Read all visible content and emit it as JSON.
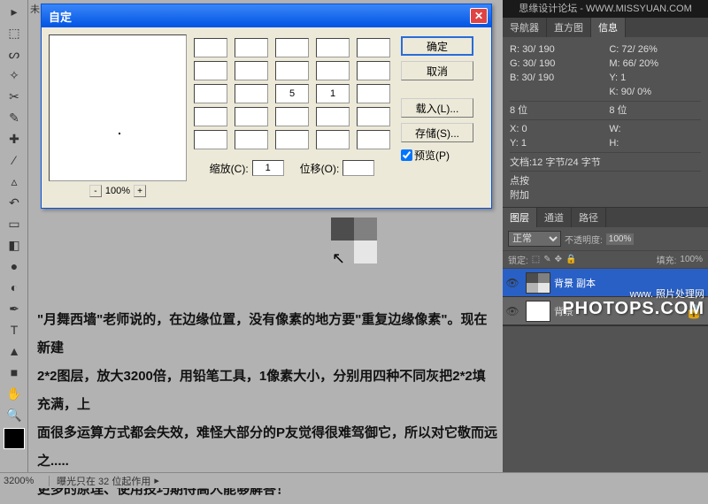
{
  "brand_top": "思缘设计论坛 - WWW.MISSYUAN.COM",
  "doc_tab_prefix": "未",
  "dialog": {
    "title": "自定",
    "ok": "确定",
    "cancel": "取消",
    "load": "载入(L)...",
    "save": "存储(S)...",
    "preview": "预览(P)",
    "zoom": "100%",
    "scale_label": "缩放(C):",
    "scale_value": "1",
    "offset_label": "位移(O):",
    "offset_value": "",
    "cells": [
      "",
      "",
      "",
      "",
      "",
      "",
      "",
      "",
      "",
      "",
      "",
      "",
      "5",
      "1",
      "",
      "",
      "",
      "",
      "",
      "",
      "",
      "",
      "",
      "",
      ""
    ]
  },
  "info_tabs": {
    "nav": "导航器",
    "hist": "直方图",
    "info": "信息"
  },
  "info": {
    "R": "30/ 190",
    "G": "30/ 190",
    "B": "30/ 190",
    "C": "72/  26%",
    "M": "66/  20%",
    "Y": "1",
    "K": "90/    0%",
    "bits_l": "8 位",
    "bits_r": "8 位",
    "X": "0",
    "W": "",
    "H": "",
    "doc": "文档:12 字节/24 字节",
    "hint1": "点按",
    "hint2": "附加"
  },
  "layer_tabs": {
    "layer": "图层",
    "channel": "通道",
    "path": "路径"
  },
  "layers_panel": {
    "mode": "正常",
    "opacity_label": "不透明度:",
    "opacity": "100%",
    "lock_label": "锁定:",
    "fill_label": "填充:",
    "fill": "100%"
  },
  "layers": [
    {
      "name": "背景 副本",
      "selected": true
    },
    {
      "name": "背景",
      "selected": false
    }
  ],
  "watermark": {
    "line1": "www.",
    "line2": "照片处理网",
    "line3": "PHOTOPS.COM"
  },
  "article": {
    "p1": "\"月舞西墙\"老师说的，在边缘位置，没有像素的地方要\"重复边缘像素\"。现在新建",
    "p2": "2*2图层，放大3200倍，用铅笔工具，1像素大小，分别用四种不同灰把2*2填充满，上",
    "p3": "面很多运算方式都会失效，难怪大部分的P友觉得很难驾御它，所以对它敬而远之.....",
    "p4": "更多的原理、使用技巧期待高人能够解答！"
  },
  "status": {
    "zoom": "3200%",
    "msg": "曝光只在 32 位起作用"
  },
  "tools": [
    "▸",
    "□",
    "◫",
    "✎",
    "◌",
    "✂",
    "✚",
    "▤",
    "✦",
    "◔",
    "▭",
    "⌫",
    "◧",
    "●",
    "◐",
    "A",
    "T",
    "▲",
    "▦",
    "✋",
    "🔍"
  ]
}
